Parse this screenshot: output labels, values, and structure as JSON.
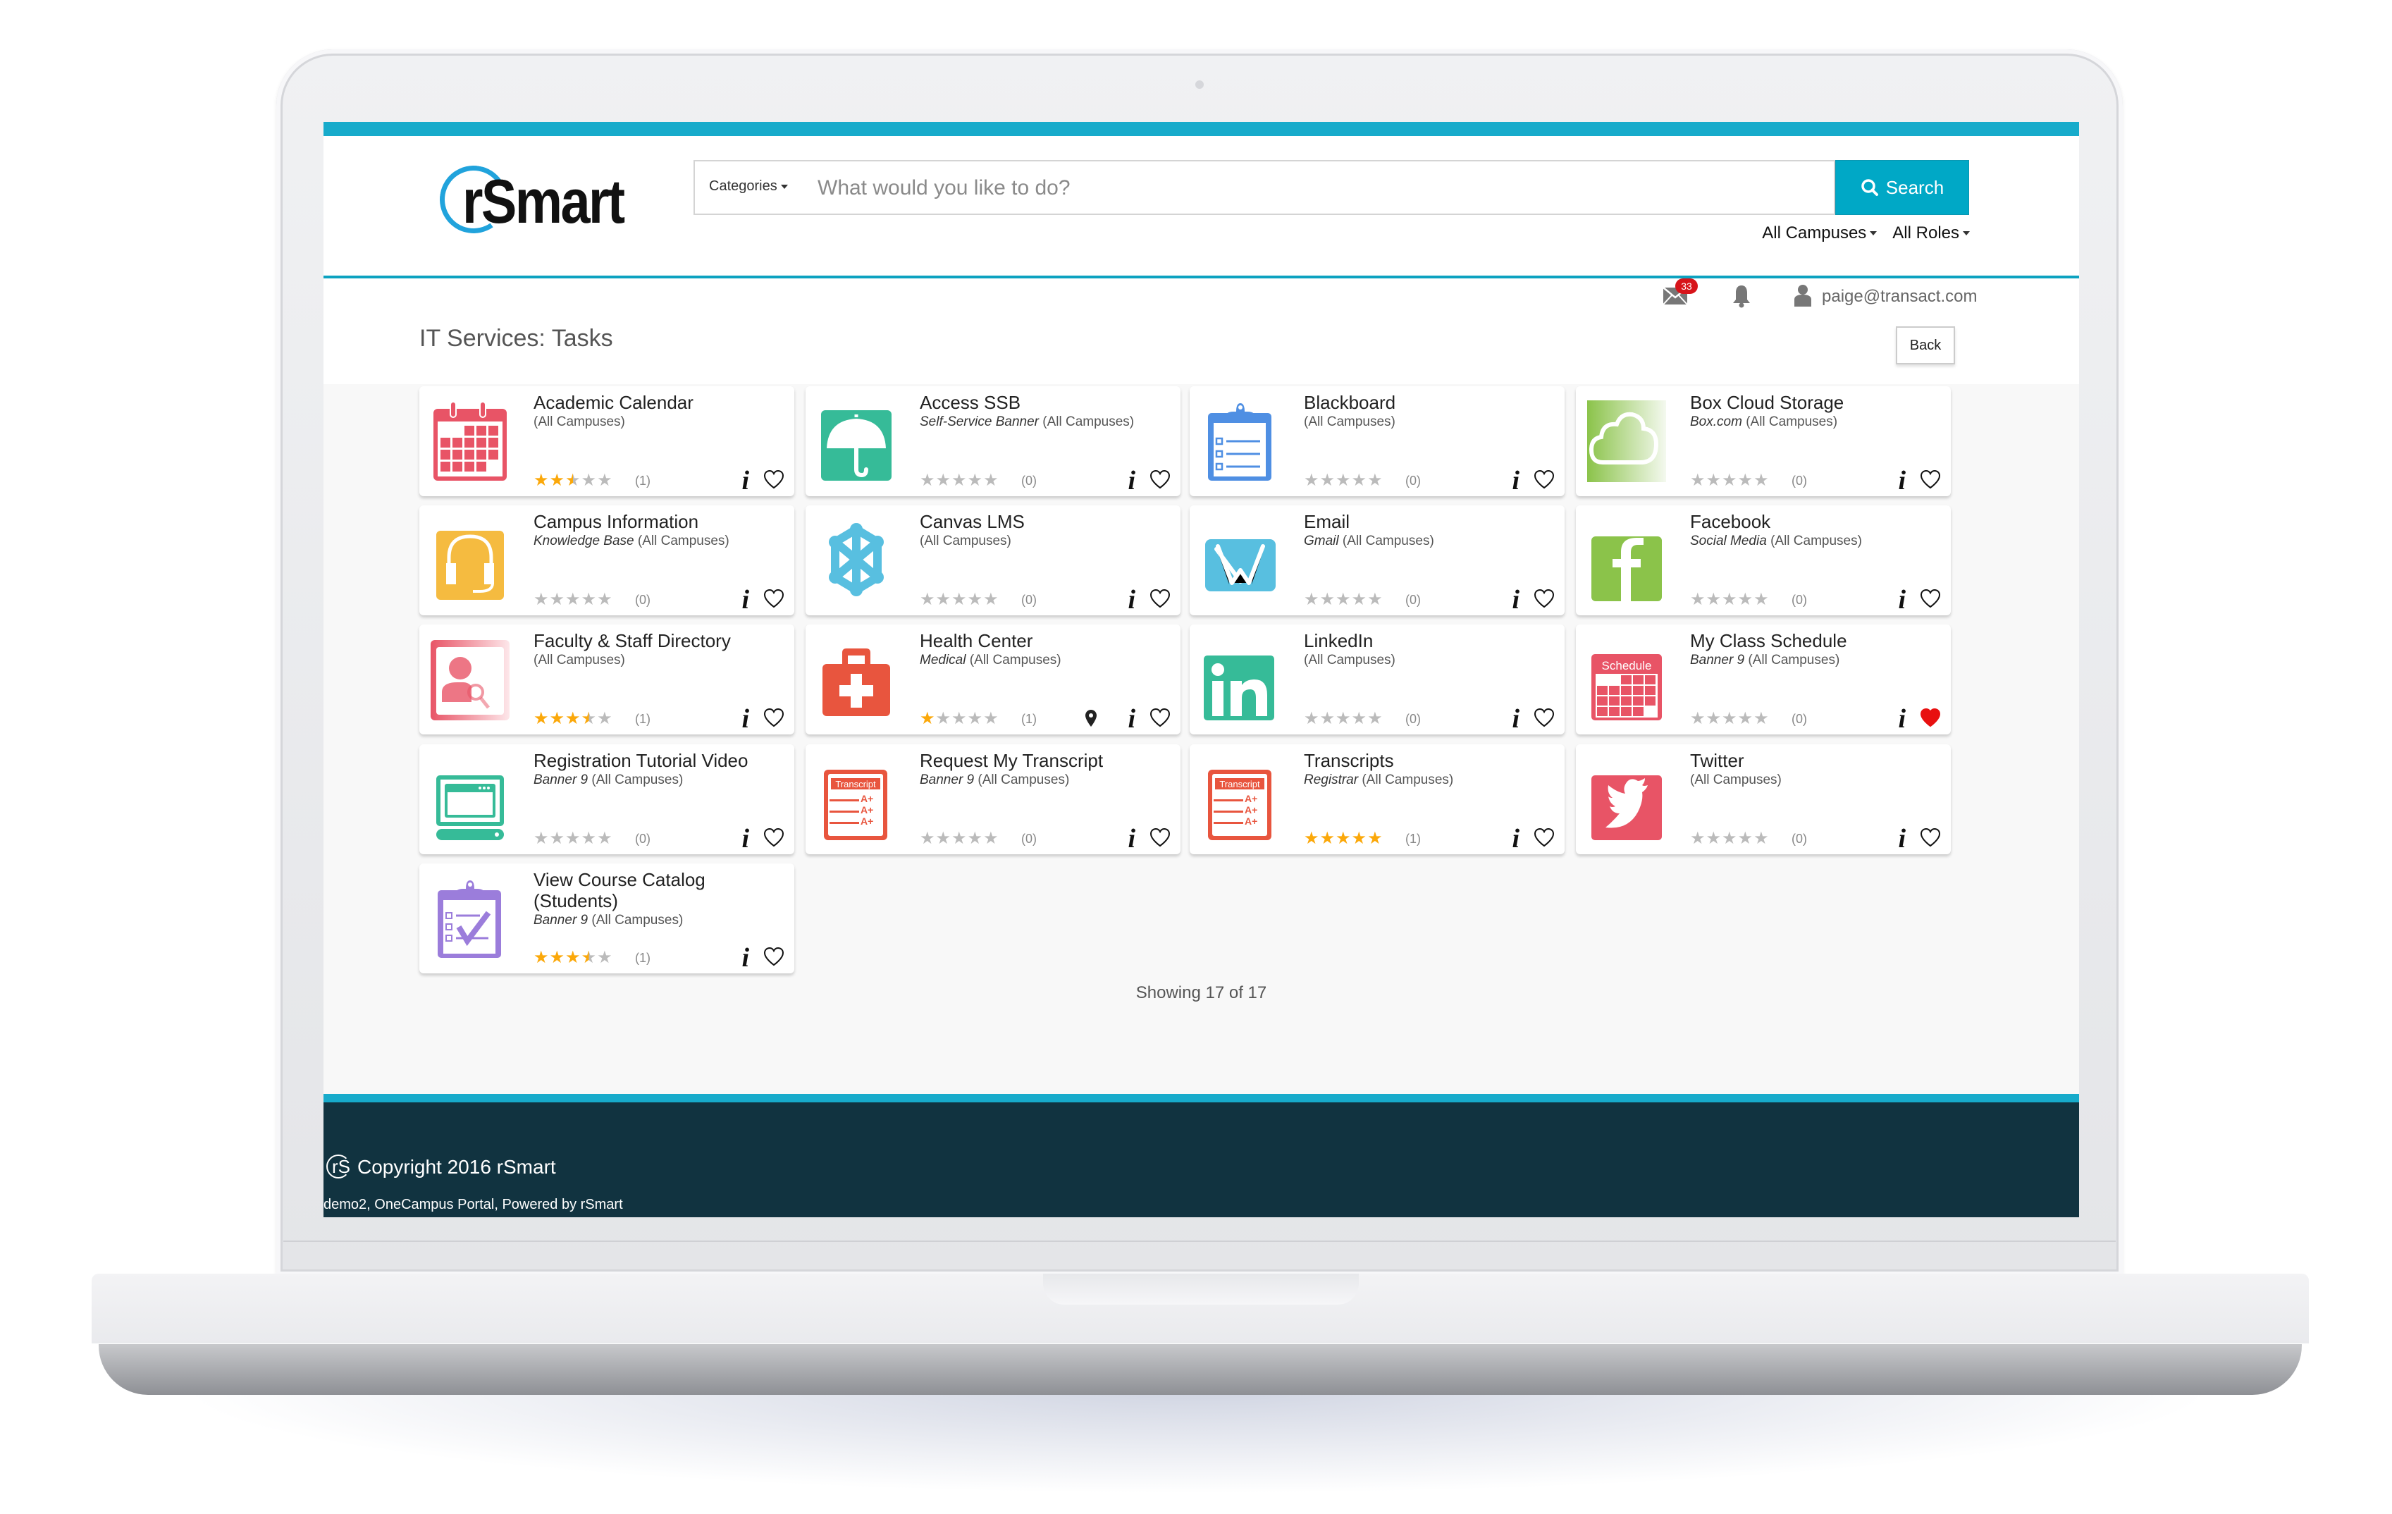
{
  "brand": {
    "name": "rSmart",
    "registered": "®",
    "accent": "#17abcb",
    "footer_bg": "#113340"
  },
  "search": {
    "categories_label": "Categories",
    "placeholder": "What would you like to do?",
    "value": "",
    "button_label": "Search"
  },
  "filters": {
    "campus": "All Campuses",
    "role": "All Roles"
  },
  "userbar": {
    "mail_count": "33",
    "email": "paige@transact.com"
  },
  "page": {
    "title": "IT Services: Tasks",
    "back_label": "Back",
    "showing": "Showing 17 of 17"
  },
  "cards": [
    {
      "title": "Academic Calendar",
      "source": "",
      "campus": "(All Campuses)",
      "rating": 2.5,
      "count": "(1)",
      "icon": "calendar-icon",
      "color": "#e85466",
      "favorite": false,
      "location": false
    },
    {
      "title": "Access SSB",
      "source": "Self-Service Banner",
      "campus": "(All Campuses)",
      "rating": 0,
      "count": "(0)",
      "icon": "umbrella-icon",
      "color": "#36bb98",
      "favorite": false,
      "location": false
    },
    {
      "title": "Blackboard",
      "source": "",
      "campus": "(All Campuses)",
      "rating": 0,
      "count": "(0)",
      "icon": "clipboard-list-icon",
      "color": "#4f8fe3",
      "favorite": false,
      "location": false
    },
    {
      "title": "Box Cloud Storage",
      "source": "Box.com",
      "campus": "(All Campuses)",
      "rating": 0,
      "count": "(0)",
      "icon": "cloud-icon",
      "color": "#8bc34a",
      "favorite": false,
      "location": false
    },
    {
      "title": "Campus Information",
      "source": "Knowledge Base",
      "campus": "(All Campuses)",
      "rating": 0,
      "count": "(0)",
      "icon": "headset-icon",
      "color": "#f5bb40",
      "favorite": false,
      "location": false
    },
    {
      "title": "Canvas LMS",
      "source": "",
      "campus": "(All Campuses)",
      "rating": 0,
      "count": "(0)",
      "icon": "canvas-network-icon",
      "color": "#58bfe0",
      "favorite": false,
      "location": false
    },
    {
      "title": "Email",
      "source": "Gmail",
      "campus": "(All Campuses)",
      "rating": 0,
      "count": "(0)",
      "icon": "envelope-icon",
      "color": "#58bfe0",
      "favorite": false,
      "location": false
    },
    {
      "title": "Facebook",
      "source": "Social Media",
      "campus": "(All Campuses)",
      "rating": 0,
      "count": "(0)",
      "icon": "facebook-icon",
      "color": "#8bc34a",
      "favorite": false,
      "location": false
    },
    {
      "title": "Faculty & Staff Directory",
      "source": "",
      "campus": "(All Campuses)",
      "rating": 3.5,
      "count": "(1)",
      "icon": "person-search-icon",
      "color": "#e85466",
      "favorite": false,
      "location": false
    },
    {
      "title": "Health Center",
      "source": "Medical",
      "campus": "(All Campuses)",
      "rating": 1,
      "count": "(1)",
      "icon": "medical-kit-icon",
      "color": "#e8553e",
      "favorite": false,
      "location": true
    },
    {
      "title": "LinkedIn",
      "source": "",
      "campus": "(All Campuses)",
      "rating": 0,
      "count": "(0)",
      "icon": "linkedin-icon",
      "color": "#36bb98",
      "favorite": false,
      "location": false
    },
    {
      "title": "My Class Schedule",
      "source": "Banner 9",
      "campus": "(All Campuses)",
      "rating": 0,
      "count": "(0)",
      "icon": "schedule-icon",
      "color": "#e85466",
      "favorite": true,
      "location": false,
      "icon_text": "Schedule"
    },
    {
      "title": "Registration Tutorial Video",
      "source": "Banner 9",
      "campus": "(All Campuses)",
      "rating": 0,
      "count": "(0)",
      "icon": "computer-icon",
      "color": "#36bb98",
      "favorite": false,
      "location": false
    },
    {
      "title": "Request My Transcript",
      "source": "Banner 9",
      "campus": "(All Campuses)",
      "rating": 0,
      "count": "(0)",
      "icon": "transcript-icon",
      "color": "#e8553e",
      "favorite": false,
      "location": false,
      "icon_text": "Transcript"
    },
    {
      "title": "Transcripts",
      "source": "Registrar",
      "campus": "(All Campuses)",
      "rating": 5,
      "count": "(1)",
      "icon": "transcript-icon",
      "color": "#e8553e",
      "favorite": false,
      "location": false,
      "icon_text": "Transcript"
    },
    {
      "title": "Twitter",
      "source": "",
      "campus": "(All Campuses)",
      "rating": 0,
      "count": "(0)",
      "icon": "twitter-icon",
      "color": "#e85466",
      "favorite": false,
      "location": false
    },
    {
      "title": "View Course Catalog (Students)",
      "source": "Banner 9",
      "campus": "(All Campuses)",
      "rating": 3.5,
      "count": "(1)",
      "icon": "clipboard-check-icon",
      "color": "#9b7ddb",
      "favorite": false,
      "location": false
    }
  ],
  "footer": {
    "copyright": "Copyright 2016 rSmart",
    "mini_logo": "rS",
    "powered": "demo2, OneCampus Portal, Powered by rSmart"
  }
}
